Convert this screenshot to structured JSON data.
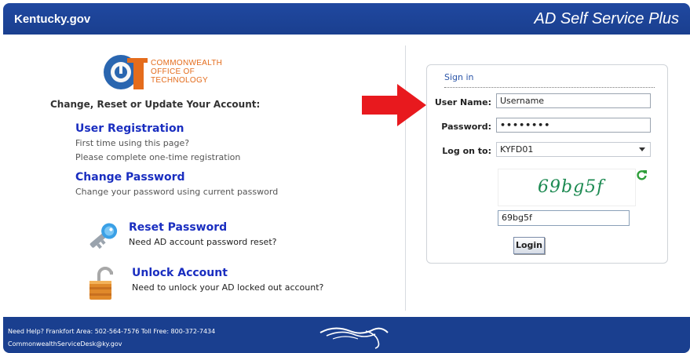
{
  "header": {
    "brand": "Kentucky.gov",
    "app_title": "AD Self Service Plus"
  },
  "logo": {
    "line1": "COMMONWEALTH",
    "line2": "OFFICE OF",
    "line3": "TECHNOLOGY"
  },
  "left": {
    "heading": "Change, Reset or Update Your Account:",
    "user_registration": {
      "title": "User Registration",
      "desc1": "First time using this page?",
      "desc2": "Please complete one-time registration"
    },
    "change_password": {
      "title": "Change Password",
      "desc": "Change your password using current password"
    },
    "reset_password": {
      "title": "Reset Password",
      "desc": "Need AD account password reset?"
    },
    "unlock_account": {
      "title": "Unlock Account",
      "desc": "Need to unlock your AD locked out account?"
    }
  },
  "signin": {
    "title": "Sign in",
    "username_label": "User Name:",
    "username_value": "Username",
    "password_label": "Password:",
    "password_value": "••••••••",
    "logon_label": "Log on to:",
    "logon_value": "KYFD01",
    "captcha_text": "69bg5f",
    "captcha_input": "69bg5f",
    "login_label": "Login"
  },
  "footer": {
    "help": "Need Help? Frankfort Area: 502-564-7576 Toll Free: 800-372-7434",
    "email": "CommonwealthServiceDesk@ky.gov"
  },
  "colors": {
    "header": "#1a3f8f",
    "link": "#1a2ec0",
    "accent": "#e46c1c",
    "arrow": "#e8191e"
  }
}
